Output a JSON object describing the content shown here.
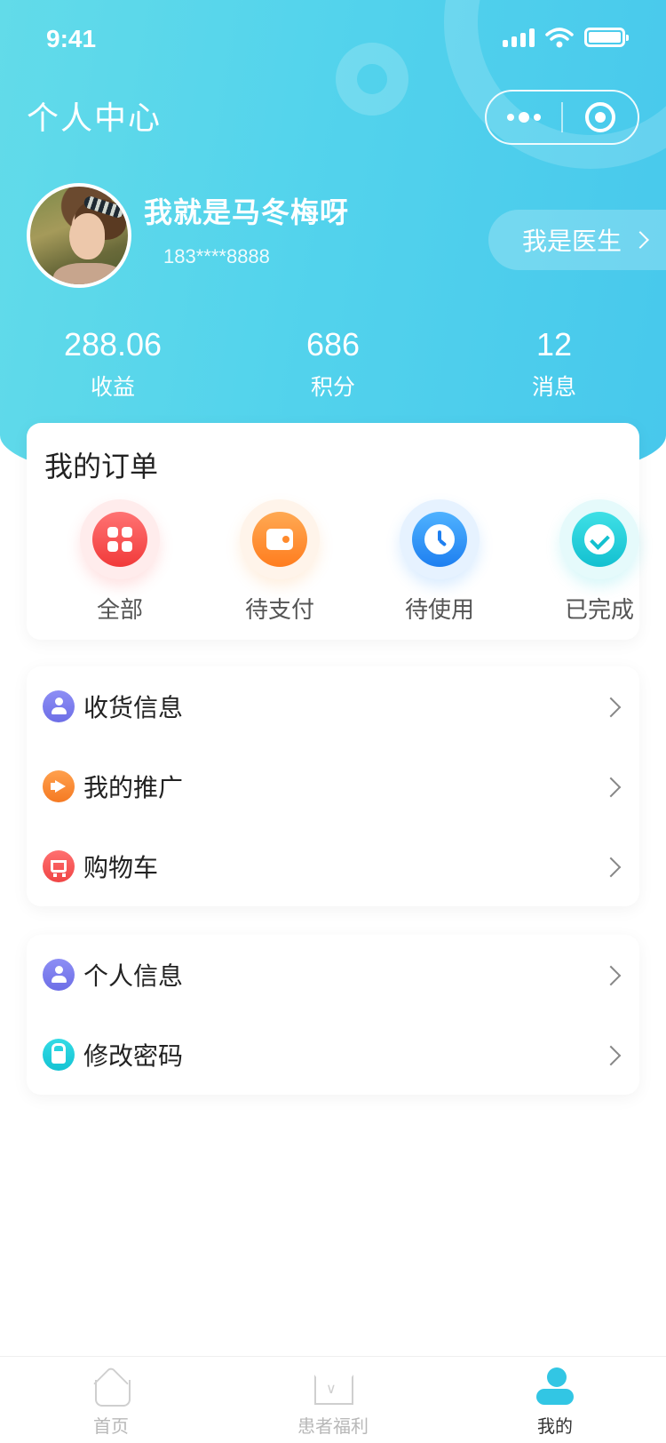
{
  "status_bar": {
    "time": "9:41"
  },
  "header": {
    "title": "个人中心"
  },
  "profile": {
    "name": "我就是马冬梅呀",
    "phone": "183****8888",
    "doctor_button": "我是医生"
  },
  "stats": [
    {
      "value": "288.06",
      "label": "收益"
    },
    {
      "value": "686",
      "label": "积分"
    },
    {
      "value": "12",
      "label": "消息"
    }
  ],
  "orders": {
    "title": "我的订单",
    "items": [
      {
        "label": "全部",
        "icon": "grid-icon",
        "color": "#f13a3a"
      },
      {
        "label": "待支付",
        "icon": "wallet-icon",
        "color": "#ff7d1f"
      },
      {
        "label": "待使用",
        "icon": "clock-icon",
        "color": "#1e7ff0"
      },
      {
        "label": "已完成",
        "icon": "check-icon",
        "color": "#13c0d0"
      }
    ]
  },
  "menu_group1": [
    {
      "label": "收货信息",
      "icon": "user-icon",
      "color": "#6d6ee6"
    },
    {
      "label": "我的推广",
      "icon": "megaphone-icon",
      "color": "#f57a23"
    },
    {
      "label": "购物车",
      "icon": "cart-icon",
      "color": "#f04545"
    }
  ],
  "menu_group2": [
    {
      "label": "个人信息",
      "icon": "person-icon",
      "color": "#6d6ee6"
    },
    {
      "label": "修改密码",
      "icon": "lock-icon",
      "color": "#14c3d3"
    }
  ],
  "tabbar": [
    {
      "label": "首页",
      "icon": "home-icon",
      "active": false
    },
    {
      "label": "患者福利",
      "icon": "crown-icon",
      "active": false
    },
    {
      "label": "我的",
      "icon": "profile-icon",
      "active": true
    }
  ],
  "colors": {
    "header_gradient_start": "#62dbe9",
    "header_gradient_end": "#47c8ec",
    "active_tab": "#32c6e4"
  }
}
